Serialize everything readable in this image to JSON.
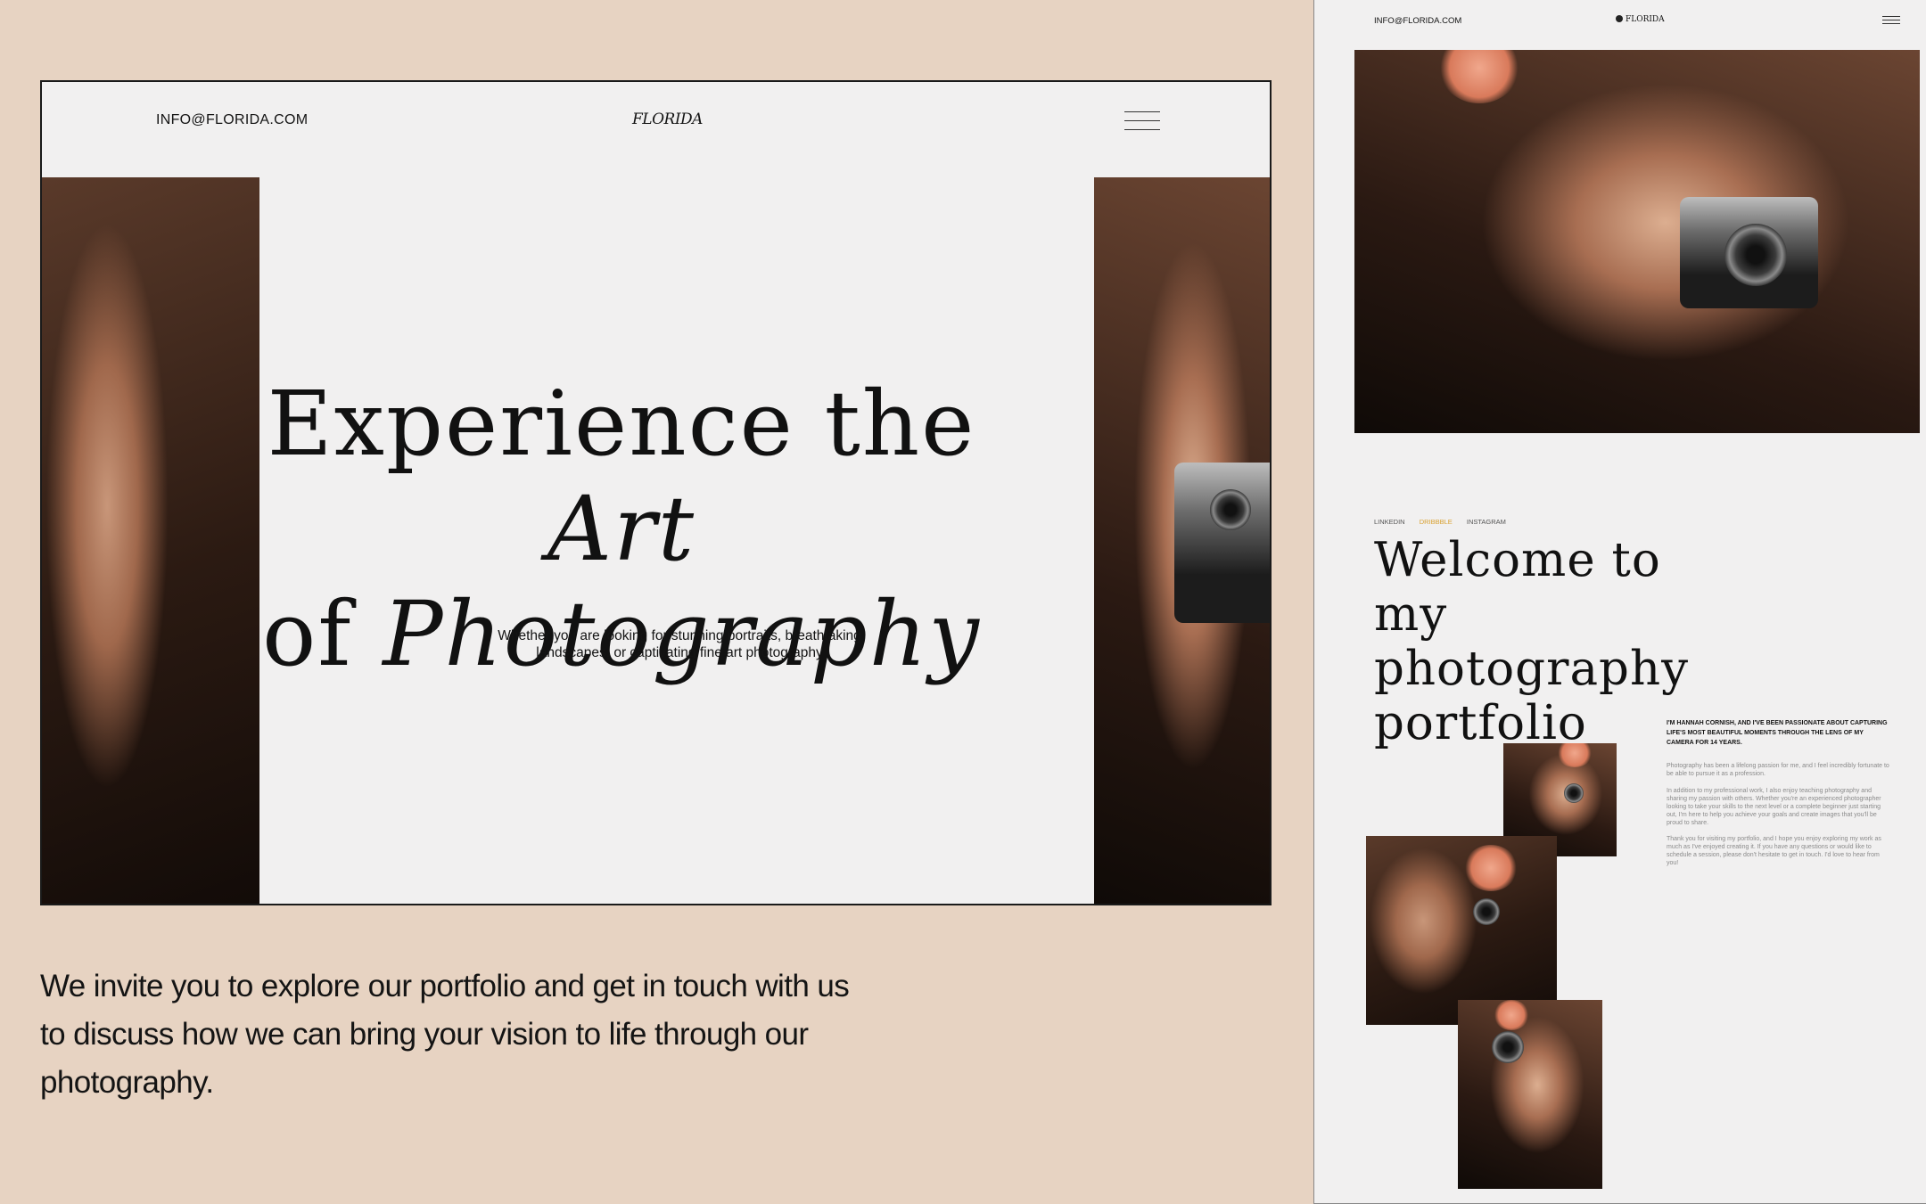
{
  "desktop": {
    "header": {
      "email": "INFO@FLORIDA.COM",
      "logo": "FLORIDA",
      "menu_icon": "hamburger-menu-icon"
    },
    "hero": {
      "title_line1_plain": "Experience the ",
      "title_line1_italic": "Art",
      "title_line2_plain": "of ",
      "title_line2_italic": "Photography",
      "subtitle": "Whether you are looking for stunning portraits, breathtaking landscapes, or captivating fine art photography"
    }
  },
  "invite_text": "We invite you to explore our portfolio and get in touch with us to discuss how we can bring your vision to life through our photography.",
  "mobile": {
    "header": {
      "email": "INFO@FLORIDA.COM",
      "logo": "FLORIDA",
      "menu_icon": "hamburger-menu-icon"
    },
    "socials": [
      "LINKEDIN",
      "DRIBBBLE",
      "INSTAGRAM"
    ],
    "welcome_title": "Welcome to my photography portfolio",
    "about_intro": "I'M HANNAH CORNISH, AND I'VE BEEN PASSIONATE ABOUT CAPTURING LIFE'S MOST BEAUTIFUL MOMENTS THROUGH THE LENS OF MY CAMERA FOR 14 YEARS.",
    "about_p1": "Photography has been a lifelong passion for me, and I feel incredibly fortunate to be able to pursue it as a profession.",
    "about_p2": "In addition to my professional work, I also enjoy teaching photography and sharing my passion with others. Whether you're an experienced photographer looking to take your skills to the next level or a complete beginner just starting out, I'm here to help you achieve your goals and create images that you'll be proud to share.",
    "about_p3": "Thank you for visiting my portfolio, and I hope you enjoy exploring my work as much as I've enjoyed creating it. If you have any questions or would like to schedule a session, please don't hesitate to get in touch. I'd love to hear from you!"
  },
  "colors": {
    "background": "#e7d3c2",
    "page": "#f1f0f0",
    "accent_dribbble": "#d9a233"
  }
}
